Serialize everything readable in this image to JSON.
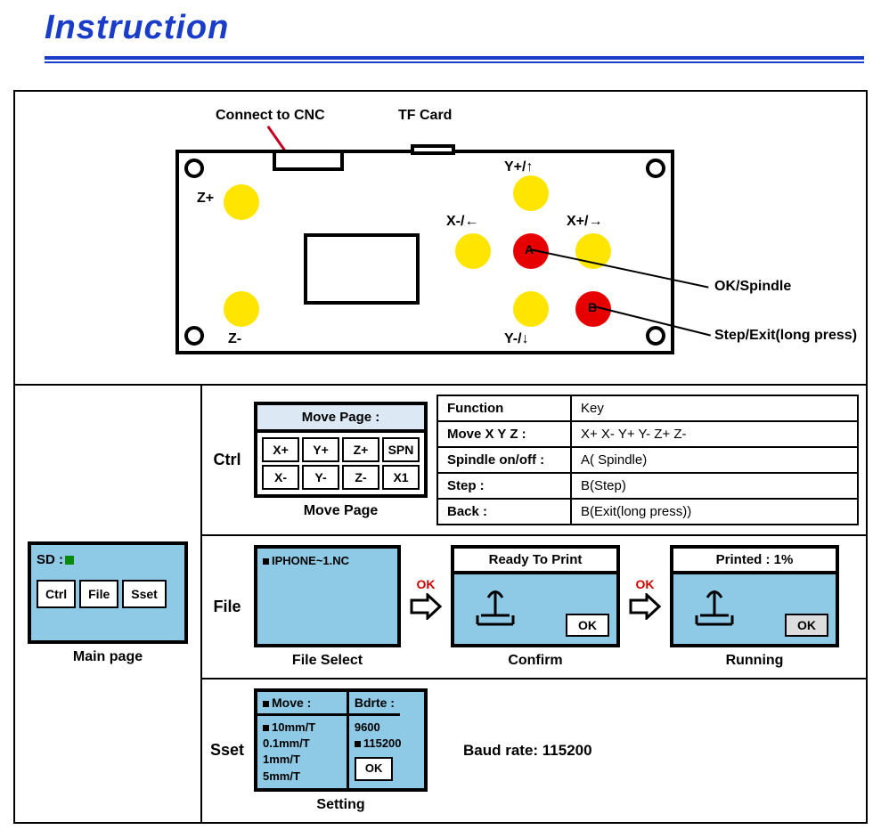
{
  "title": "Instruction",
  "board": {
    "connectLabel": "Connect to CNC",
    "tfLabel": "TF Card",
    "zPlus": "Z+",
    "zMinus": "Z-",
    "yPlus": "Y+/↑",
    "yMinus": "Y-/↓",
    "xPlus": "X+/→",
    "xMinus": "X-/←",
    "letterA": "A",
    "letterB": "B",
    "okSpindle": "OK/Spindle",
    "stepExit": "Step/Exit(long press)"
  },
  "mainPage": {
    "sd": "SD :",
    "ctrl": "Ctrl",
    "file": "File",
    "sset": "Sset",
    "caption": "Main page"
  },
  "ctrlRow": {
    "label": "Ctrl",
    "header": "Move Page :",
    "cells": [
      "X+",
      "Y+",
      "Z+",
      "SPN",
      "X-",
      "Y-",
      "Z-",
      "X1"
    ],
    "caption": "Move Page"
  },
  "funcTable": {
    "r1c1": "Function",
    "r1c2": "Key",
    "r2c1": "Move X Y Z :",
    "r2c2": "X+  X-  Y+  Y-  Z+  Z-",
    "r3c1": "Spindle on/off :",
    "r3c2": "A( Spindle)",
    "r4c1": "Step :",
    "r4c2": "B(Step)",
    "r5c1": "Back :",
    "r5c2": "B(Exit(long press))"
  },
  "fileRow": {
    "label": "File",
    "filename": "IPHONE~1.NC",
    "fileCaption": "File Select",
    "ok": "OK",
    "ready": "Ready To Print",
    "confirmCaption": "Confirm",
    "printed": "Printed : 1%",
    "runningCaption": "Running",
    "okBtn": "OK"
  },
  "settingRow": {
    "label": "Sset",
    "moveHeader": "Move :",
    "bdrteHeader": "Bdrte :",
    "moves": [
      "10mm/T",
      "0.1mm/T",
      "1mm/T",
      "5mm/T"
    ],
    "baud1": "9600",
    "baud2": "115200",
    "ok": "OK",
    "caption": "Setting",
    "baudText": "Baud rate: 115200"
  }
}
